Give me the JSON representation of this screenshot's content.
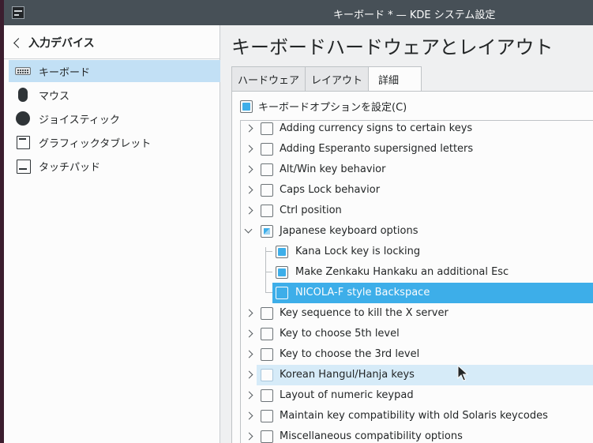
{
  "window": {
    "title": "キーボード * — KDE システム設定"
  },
  "sidebar": {
    "back_label": "入力デバイス",
    "items": [
      {
        "label": "キーボード",
        "icon": "keyboard-icon",
        "selected": true
      },
      {
        "label": "マウス",
        "icon": "mouse-icon"
      },
      {
        "label": "ジョイスティック",
        "icon": "joystick-icon"
      },
      {
        "label": "グラフィックタブレット",
        "icon": "tablet-icon"
      },
      {
        "label": "タッチパッド",
        "icon": "touchpad-icon"
      }
    ]
  },
  "main": {
    "title": "キーボードハードウェアとレイアウト",
    "tabs": [
      {
        "label": "ハードウェア"
      },
      {
        "label": "レイアウト"
      },
      {
        "label": "詳細",
        "active": true
      }
    ],
    "configure_options_label": "キーボードオプションを設定(C)",
    "configure_options_checked": true,
    "tree": [
      {
        "label": "Adding currency signs to certain keys",
        "checked": false
      },
      {
        "label": "Adding Esperanto supersigned letters",
        "checked": false
      },
      {
        "label": "Alt/Win key behavior",
        "checked": false
      },
      {
        "label": "Caps Lock behavior",
        "checked": false
      },
      {
        "label": "Ctrl position",
        "checked": false
      },
      {
        "label": "Japanese keyboard options",
        "checked": "partial",
        "expanded": true,
        "children": [
          {
            "label": "Kana Lock key is locking",
            "checked": true
          },
          {
            "label": "Make Zenkaku Hankaku an additional Esc",
            "checked": true
          },
          {
            "label": "NICOLA-F style Backspace",
            "checked": false,
            "selected": true
          }
        ]
      },
      {
        "label": "Key sequence to kill the X server",
        "checked": false
      },
      {
        "label": "Key to choose 5th level",
        "checked": false
      },
      {
        "label": "Key to choose the 3rd level",
        "checked": false
      },
      {
        "label": "Korean Hangul/Hanja keys",
        "checked": false,
        "hovered": true
      },
      {
        "label": "Layout of numeric keypad",
        "checked": false
      },
      {
        "label": "Maintain key compatibility with old Solaris keycodes",
        "checked": false
      },
      {
        "label": "Miscellaneous compatibility options",
        "checked": false
      }
    ]
  },
  "colors": {
    "accent": "#3daee9",
    "selection_bg": "#c2e0f5",
    "titlebar": "#475057"
  }
}
